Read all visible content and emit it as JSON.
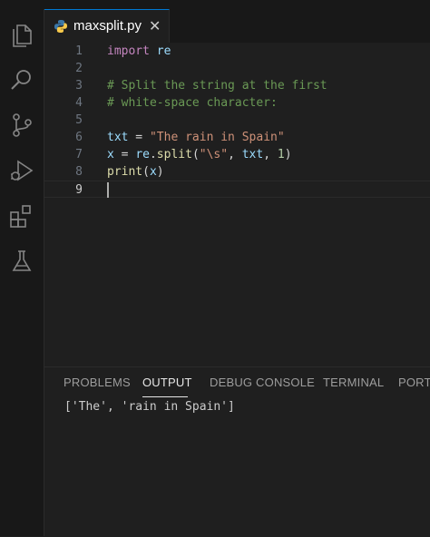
{
  "tab": {
    "filename": "maxsplit.py",
    "close_glyph": "✕"
  },
  "editor": {
    "lines": [
      {
        "n": "1",
        "tokens": [
          [
            "kw",
            "import"
          ],
          [
            "op",
            " "
          ],
          [
            "var",
            "re"
          ]
        ]
      },
      {
        "n": "2",
        "tokens": []
      },
      {
        "n": "3",
        "tokens": [
          [
            "cm",
            "# Split the string at the first"
          ]
        ]
      },
      {
        "n": "4",
        "tokens": [
          [
            "cm",
            "# white-space character:"
          ]
        ]
      },
      {
        "n": "5",
        "tokens": []
      },
      {
        "n": "6",
        "tokens": [
          [
            "var",
            "txt"
          ],
          [
            "op",
            " = "
          ],
          [
            "str",
            "\"The rain in Spain\""
          ]
        ]
      },
      {
        "n": "7",
        "tokens": [
          [
            "var",
            "x"
          ],
          [
            "op",
            " = "
          ],
          [
            "var",
            "re"
          ],
          [
            "op",
            "."
          ],
          [
            "fn",
            "split"
          ],
          [
            "op",
            "("
          ],
          [
            "str",
            "\"\\s\""
          ],
          [
            "op",
            ", "
          ],
          [
            "var",
            "txt"
          ],
          [
            "op",
            ", "
          ],
          [
            "num",
            "1"
          ],
          [
            "op",
            ")"
          ]
        ]
      },
      {
        "n": "8",
        "tokens": [
          [
            "fn",
            "print"
          ],
          [
            "op",
            "("
          ],
          [
            "var",
            "x"
          ],
          [
            "op",
            ")"
          ]
        ]
      },
      {
        "n": "9",
        "tokens": [],
        "current": true
      }
    ]
  },
  "panel": {
    "tabs": [
      "PROBLEMS",
      "OUTPUT",
      "DEBUG CONSOLE",
      "TERMINAL",
      "PORTS"
    ],
    "active_tab": "OUTPUT",
    "output": "['The', 'rain in Spain']"
  },
  "activity_bar": [
    "explorer-icon",
    "search-icon",
    "source-control-icon",
    "run-debug-icon",
    "extensions-icon",
    "testing-icon"
  ],
  "colors": {
    "accent": "#0078d4",
    "background": "#1f1f1f",
    "keyword": "#c586c0",
    "comment": "#6a9955",
    "string": "#ce9178"
  }
}
